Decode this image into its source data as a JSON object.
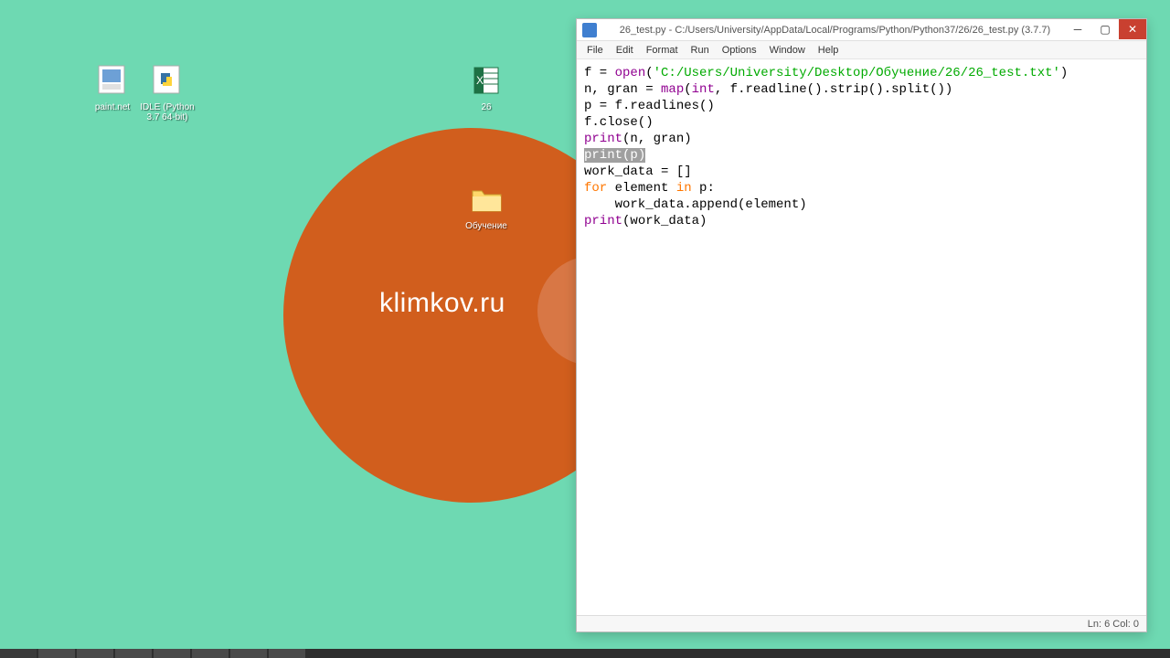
{
  "wallpaper": {
    "brand_text": "klimkov.ru"
  },
  "desktop_icons": {
    "paintnet": {
      "label": "paint.net"
    },
    "idle": {
      "label": "IDLE (Python 3.7 64-bit)"
    },
    "excel": {
      "label": "26"
    },
    "folder": {
      "label": "Обучение"
    }
  },
  "idle": {
    "title": "26_test.py - C:/Users/University/AppData/Local/Programs/Python/Python37/26/26_test.py (3.7.7)",
    "menu": {
      "file": "File",
      "edit": "Edit",
      "format": "Format",
      "run": "Run",
      "options": "Options",
      "window": "Window",
      "help": "Help"
    },
    "code": {
      "l1_assign": "f = ",
      "l1_open": "open",
      "l1_paren_open": "(",
      "l1_str": "'C:/Users/University/Desktop/Обучение/26/26_test.txt'",
      "l1_paren_close": ")",
      "l2_left": "n, gran = ",
      "l2_map": "map",
      "l2_paren_open": "(",
      "l2_int": "int",
      "l2_rest": ", f.readline().strip().split())",
      "l3": "p = f.readlines()",
      "l4": "f.close()",
      "l5_print": "print",
      "l5_args": "(n, gran)",
      "l6_print": "print",
      "l6_args": "(p)",
      "l7": "work_data = []",
      "l8_for": "for",
      "l8_mid": " element ",
      "l8_in": "in",
      "l8_end": " p:",
      "l9": "    work_data.append(element)",
      "l10_print": "print",
      "l10_args": "(work_data)"
    },
    "status": "Ln: 6  Col: 0"
  }
}
